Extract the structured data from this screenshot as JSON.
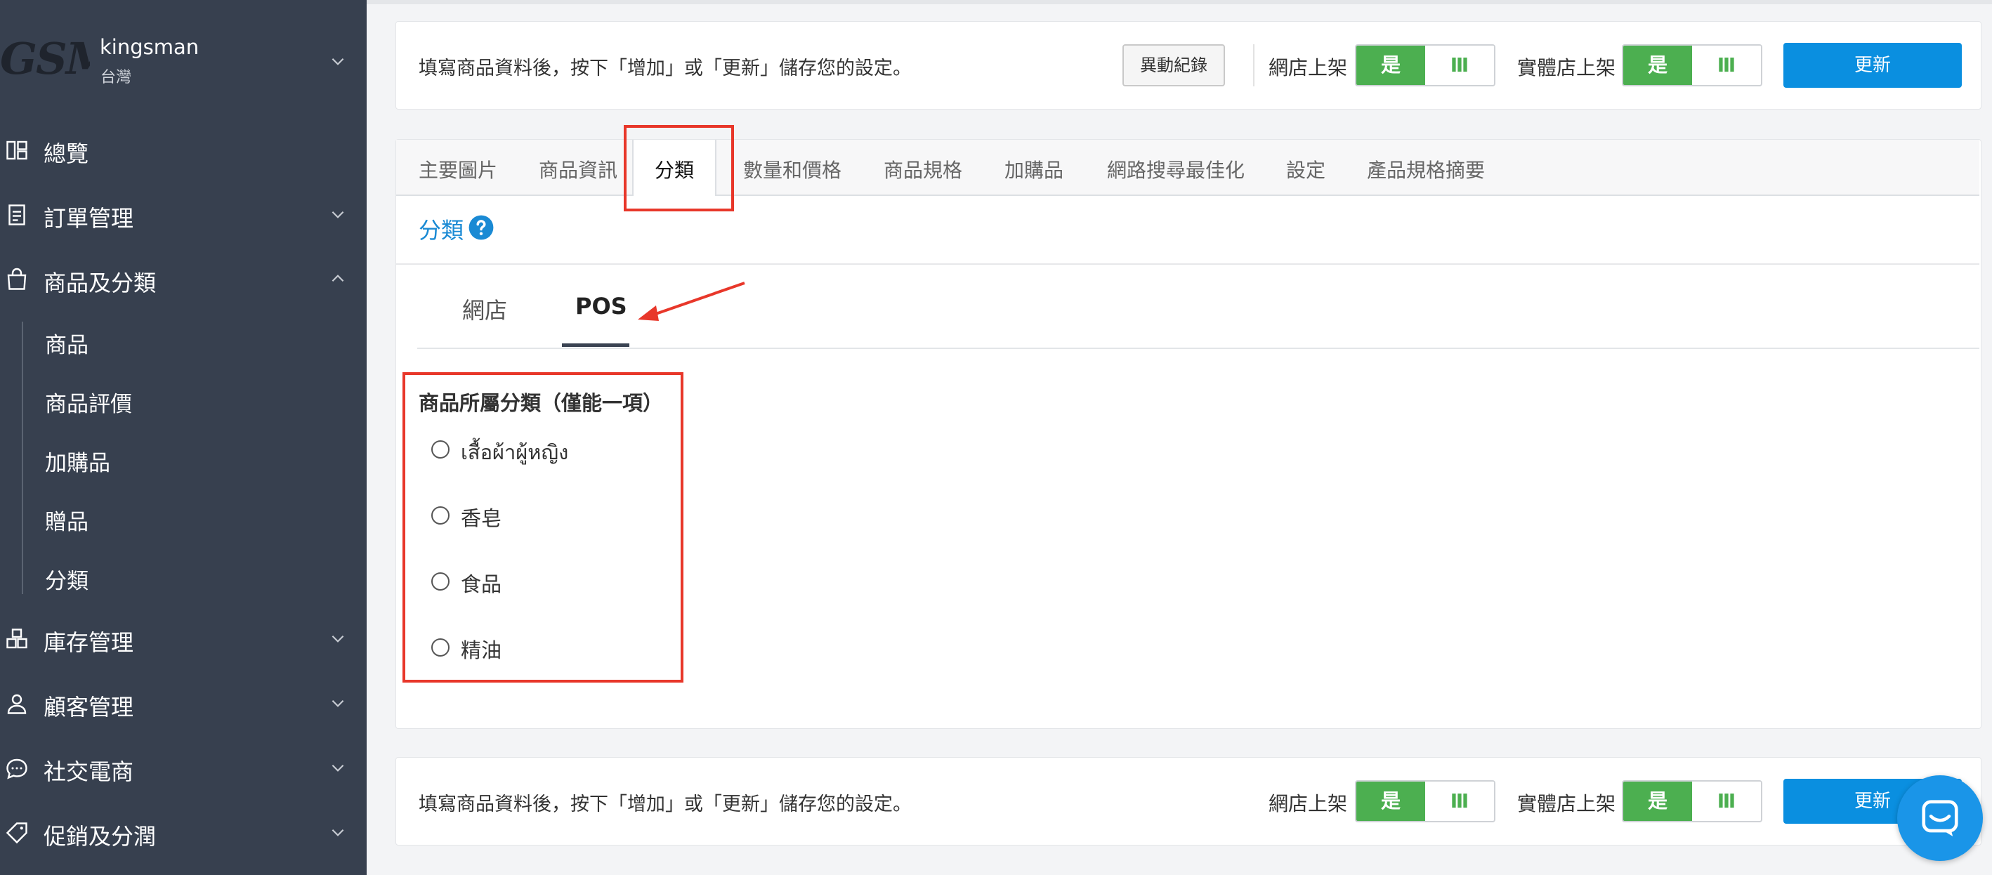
{
  "sidebar": {
    "logo_text": "GSM",
    "store_name": "kingsman",
    "store_region": "台灣",
    "items": [
      {
        "label": "總覽"
      },
      {
        "label": "訂單管理"
      },
      {
        "label": "商品及分類"
      },
      {
        "label": "庫存管理"
      },
      {
        "label": "顧客管理"
      },
      {
        "label": "社交電商"
      },
      {
        "label": "促銷及分潤"
      }
    ],
    "sub_items": [
      {
        "label": "商品"
      },
      {
        "label": "商品評價"
      },
      {
        "label": "加購品"
      },
      {
        "label": "贈品"
      },
      {
        "label": "分類"
      }
    ]
  },
  "top_bar": {
    "hint": "填寫商品資料後，按下「增加」或「更新」儲存您的設定。",
    "log_button": "異動紀錄",
    "online_label": "網店上架",
    "offline_label": "實體店上架",
    "toggle_on": "是",
    "toggle_off": "Ⅲ",
    "update_button": "更新"
  },
  "tabs": [
    {
      "label": "主要圖片"
    },
    {
      "label": "商品資訊"
    },
    {
      "label": "分類"
    },
    {
      "label": "數量和價格"
    },
    {
      "label": "商品規格"
    },
    {
      "label": "加購品"
    },
    {
      "label": "網路搜尋最佳化"
    },
    {
      "label": "設定"
    },
    {
      "label": "產品規格摘要"
    }
  ],
  "active_tab": "分類",
  "section": {
    "title": "分類",
    "subtabs": [
      {
        "label": "網店"
      },
      {
        "label": "POS"
      }
    ],
    "active_subtab": "POS",
    "group_title": "商品所屬分類（僅能一項）",
    "options": [
      {
        "label": "เสื้อผ้าผู้หญิง"
      },
      {
        "label": "香皂"
      },
      {
        "label": "食品"
      },
      {
        "label": "精油"
      }
    ]
  },
  "bottom_bar": {
    "hint": "填寫商品資料後，按下「增加」或「更新」儲存您的設定。",
    "online_label": "網店上架",
    "offline_label": "實體店上架",
    "toggle_on": "是",
    "toggle_off": "Ⅲ",
    "update_button": "更新"
  },
  "colors": {
    "sidebar_bg": "#37404f",
    "accent_blue": "#0a8fe0",
    "toggle_green": "#4caf50",
    "annotation_red": "#e8372a"
  },
  "icons": {
    "overview": "dashboard-icon",
    "orders": "clipboard-icon",
    "products": "shopping-bag-icon",
    "inventory": "boxes-icon",
    "customers": "user-icon",
    "social": "chat-icon",
    "promotions": "tag-icon",
    "help": "question-circle-icon",
    "messenger": "messenger-icon"
  }
}
